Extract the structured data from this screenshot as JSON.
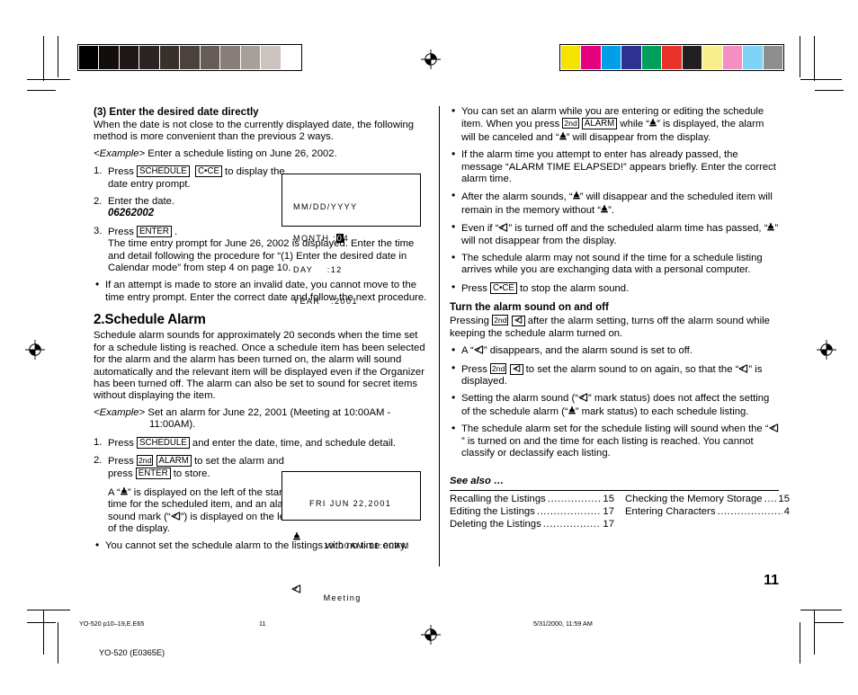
{
  "page": {
    "folio": "11",
    "doc_footer_left": "YO-520 p10–19,E.E65",
    "doc_footer_page": "11",
    "doc_footer_date": "5/31/2000, 11:59 AM",
    "doc_footer_model": "YO-520 (E0365E)"
  },
  "calibration": {
    "grayscale": [
      "#000000",
      "#130d0c",
      "#1d1715",
      "#2b2422",
      "#38302d",
      "#4b423f",
      "#655b57",
      "#877d79",
      "#a89e9a",
      "#cdc4c0",
      "#ffffff"
    ],
    "colors": [
      "#f5e400",
      "#e5007e",
      "#00a0e9",
      "#2e3192",
      "#00a05a",
      "#e8322a",
      "#231f20",
      "#faee8c",
      "#f58fc2",
      "#7fd3f4",
      "#8e8e8e"
    ]
  },
  "left_column": {
    "section3_title": "(3) Enter the desired date directly",
    "section3_body": "When the date is not close to the currently displayed date, the following method is more convenient than the previous 2 ways.",
    "example_label": "<Example>",
    "example_text": " Enter a schedule listing on June 26, 2002.",
    "step1_num": "1.",
    "step1_a": "Press ",
    "step1_key1": "SCHEDULE",
    "step1_key2": "C•CE",
    "step1_b": " to display the date entry prompt.",
    "step2_num": "2.",
    "step2_a": "Enter the date.",
    "step2_value": "06262002",
    "step3_num": "3.",
    "step3_a": "Press ",
    "step3_key1": "ENTER",
    "step3_b": " .",
    "step3_body": "The time entry prompt for June 26, 2002 is displayed. Enter the time and detail following the procedure for “(1) Enter the desired date in Calendar mode” from step 4 on page 10.",
    "bullet1": "If an attempt is made to store an invalid date, you cannot move to the time entry prompt. Enter the correct date and follow the next procedure.",
    "heading2": "2.Schedule Alarm",
    "alarm_body": "Schedule alarm sounds for approximately 20 seconds when the time set for a schedule listing is reached. Once a schedule item has been selected for the alarm and the alarm has been turned on, the alarm will sound automatically and the relevant item will be displayed even if the Organizer has been turned off. The alarm can also be set to sound for secret items without displaying the item.",
    "example2_label": "<Example>",
    "example2_text": " Set an alarm for June 22, 2001 (Meeting at 10:00AM -",
    "example2_text2": "11:00AM).",
    "a_step1_num": "1.",
    "a_step1_a": "Press ",
    "a_step1_key": "SCHEDULE",
    "a_step1_b": " and enter the date, time, and schedule detail.",
    "a_step2_num": "2.",
    "a_step2_a": "Press ",
    "a_step2_key1": "2nd",
    "a_step2_key2": "ALARM",
    "a_step2_b": " to set the alarm and press ",
    "a_step2_key3": "ENTER",
    "a_step2_c": " to store.",
    "a_step2_d1": "A “",
    "a_step2_d2": "” is displayed on the left of the starting time for the scheduled item, and an alarm sound mark (“",
    "a_step2_d3": "”) is displayed on the left of the display.",
    "a_bullet1": "You cannot set the schedule alarm to the listings with no time entry."
  },
  "lcd_date": {
    "line1": "MM/DD/YYYY",
    "line2_label": "MONTH",
    "line2_sep": " :",
    "line2_cursor": "0",
    "line2_rest": "4",
    "line3_label": "DAY",
    "line3_sep": "    :",
    "line3_val": "12",
    "line4_label": "YEAR",
    "line4_sep": "   :",
    "line4_val": "2001"
  },
  "lcd_alarm": {
    "line1": "FRI JUN 22,2001",
    "line2": "10:00AM-11:00AM",
    "line3": "Meeting",
    "line2_icon": "bell-icon",
    "line3_icon": "alarm-sound-icon"
  },
  "right_column": {
    "bullet1_a": "You can set an alarm while you are entering or editing the schedule item. When you press ",
    "bullet1_key1": "2nd",
    "bullet1_key2": "ALARM",
    "bullet1_b": " while “",
    "bullet1_c": "” is displayed, the alarm will be canceled and “",
    "bullet1_d": "” will disappear from the display.",
    "bullet2": "If the alarm time you attempt to enter has already passed, the message “ALARM TIME ELAPSED!” appears briefly. Enter the correct alarm time.",
    "bullet3_a": "After the alarm sounds, “",
    "bullet3_b": "” will disappear and the scheduled item will remain in the memory without “",
    "bullet3_c": "”.",
    "bullet4_a": "Even if “",
    "bullet4_b": "” is turned off and the scheduled alarm time has passed, “",
    "bullet4_c": "” will not disappear from the display.",
    "bullet5": "The schedule alarm may not sound if the time for a schedule listing arrives while you are exchanging data with a personal computer.",
    "bullet6_a": "Press ",
    "bullet6_key": "C•CE",
    "bullet6_b": " to stop the alarm sound.",
    "turn_title": "Turn the alarm sound on and off",
    "turn_a": "Pressing ",
    "turn_key1": "2nd",
    "turn_b": " after the alarm setting, turns off the alarm sound while keeping the schedule alarm turned on.",
    "t_bullet1_a": "A “",
    "t_bullet1_b": "” disappears, and the alarm sound is set to off.",
    "t_bullet2_a": "Press ",
    "t_bullet2_key": "2nd",
    "t_bullet2_b": " to set the alarm sound to on again, so that the “",
    "t_bullet2_c": "” is displayed.",
    "t_bullet3_a": "Setting the alarm sound (“",
    "t_bullet3_b": "” mark status) does not affect the setting of the schedule alarm (“",
    "t_bullet3_c": "” mark status) to each schedule listing.",
    "t_bullet4_a": "The schedule alarm set for the schedule listing will sound when the “",
    "t_bullet4_b": "” is turned on and the time for each listing is reached. You cannot classify or declassify each listing."
  },
  "see_also": {
    "title": "See also …",
    "left_items": [
      {
        "label": "Recalling the Listings",
        "page": "15"
      },
      {
        "label": "Editing the Listings",
        "page": "17"
      },
      {
        "label": "Deleting the Listings",
        "page": "17"
      }
    ],
    "right_items": [
      {
        "label": "Checking the Memory Storage",
        "page": "15"
      },
      {
        "label": "Entering Characters",
        "page": "4"
      }
    ],
    "leader": "......................................................................"
  }
}
